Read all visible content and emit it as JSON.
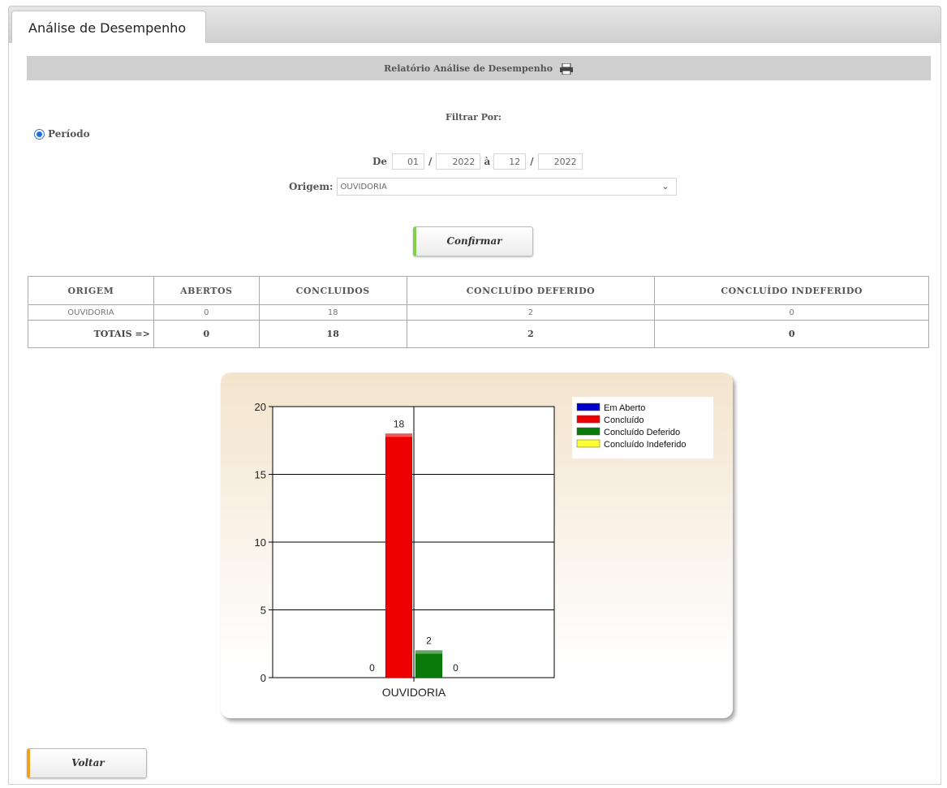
{
  "tab": {
    "label": "Análise de Desempenho"
  },
  "report": {
    "title": "Relatório Análise de Desempenho",
    "print_icon": "printer-icon"
  },
  "filter": {
    "title": "Filtrar Por:",
    "radio_label": "Período",
    "radio_checked": true,
    "de_label": "De",
    "from_month": "01",
    "from_year": "2022",
    "a_label": "à",
    "to_month": "12",
    "to_year": "2022",
    "slash": "/",
    "origem_label": "Origem:",
    "origem_value": "OUVIDORIA"
  },
  "buttons": {
    "confirm": "Confirmar",
    "back": "Voltar"
  },
  "table": {
    "headers": [
      "ORIGEM",
      "ABERTOS",
      "CONCLUIDOS",
      "CONCLUÍDO DEFERIDO",
      "CONCLUÍDO INDEFERIDO"
    ],
    "rows": [
      [
        "OUVIDORIA",
        "0",
        "18",
        "2",
        "0"
      ]
    ],
    "totals_label": "TOTAIS =>",
    "totals": [
      "0",
      "18",
      "2",
      "0"
    ]
  },
  "chart_data": {
    "type": "bar",
    "categories": [
      "OUVIDORIA"
    ],
    "series": [
      {
        "name": "Em Aberto",
        "values": [
          0
        ],
        "color": "#0000cc"
      },
      {
        "name": "Concluído",
        "values": [
          18
        ],
        "color": "#ee0000"
      },
      {
        "name": "Concluído Deferido",
        "values": [
          2
        ],
        "color": "#0a7a0a"
      },
      {
        "name": "Concluído Indeferido",
        "values": [
          0
        ],
        "color": "#ffff33"
      }
    ],
    "ylim": [
      0,
      20
    ],
    "yticks": [
      0,
      5,
      10,
      15,
      20
    ],
    "grid": true,
    "legend": "top-right"
  }
}
